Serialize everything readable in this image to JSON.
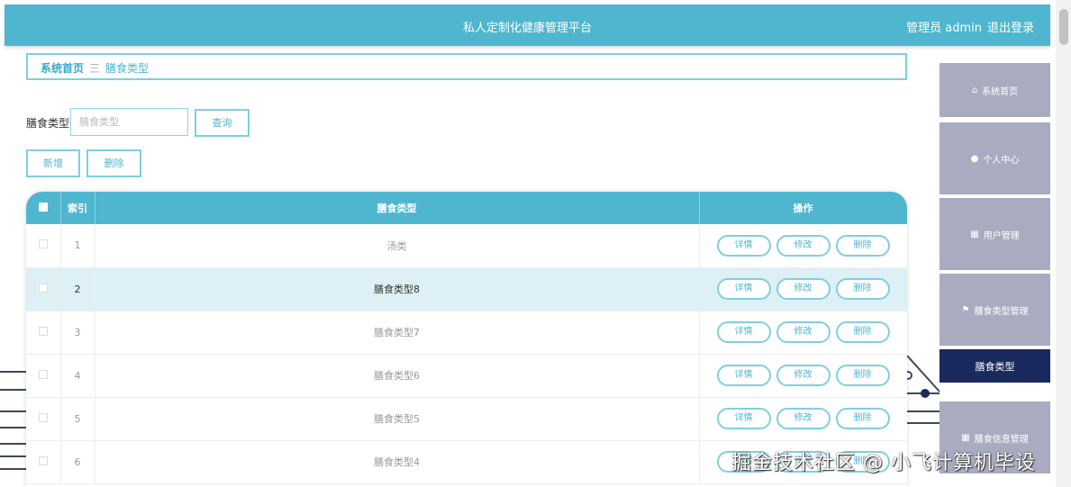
{
  "header": {
    "title": "私人定制化健康管理平台",
    "admin_label": "管理员 admin",
    "logout": "退出登录"
  },
  "breadcrumb": {
    "home": "系统首页",
    "separator": "三",
    "current": "膳食类型"
  },
  "search": {
    "label": "膳食类型",
    "placeholder": "膳食类型",
    "query_button": "查询"
  },
  "actions": {
    "add": "新增",
    "delete": "删除"
  },
  "table": {
    "headers": {
      "index": "索引",
      "type": "膳食类型",
      "ops": "操作"
    },
    "op_labels": {
      "detail": "详情",
      "edit": "修改",
      "delete": "删除"
    },
    "rows": [
      {
        "index": "1",
        "type": "汤类"
      },
      {
        "index": "2",
        "type": "膳食类型8"
      },
      {
        "index": "3",
        "type": "膳食类型7"
      },
      {
        "index": "4",
        "type": "膳食类型6"
      },
      {
        "index": "5",
        "type": "膳食类型5"
      },
      {
        "index": "6",
        "type": "膳食类型4"
      }
    ]
  },
  "sidebar": {
    "items": [
      {
        "label": "系统首页",
        "icon": "home-icon"
      },
      {
        "label": "个人中心",
        "icon": "user-icon"
      },
      {
        "label": "用户管理",
        "icon": "grid-icon"
      },
      {
        "label": "膳食类型管理",
        "icon": "flag-icon"
      },
      {
        "label": "膳食类型",
        "icon": ""
      },
      {
        "label": "膳食信息管理",
        "icon": "grid-icon"
      }
    ]
  },
  "watermark": "掘金技术社区 @ 小飞计算机毕设",
  "colors": {
    "header": "#4fb6cf",
    "sidebar": "#a9acc0",
    "sidebar_active": "#1a2a5e"
  }
}
